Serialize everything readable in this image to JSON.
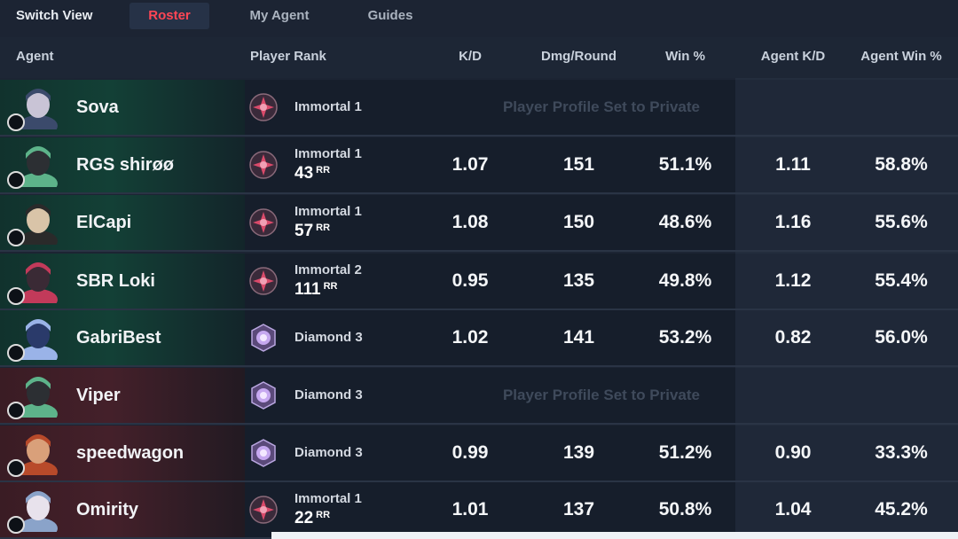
{
  "nav": {
    "switch_view": "Switch View",
    "tabs": [
      {
        "label": "Roster",
        "active": true
      },
      {
        "label": "My Agent",
        "active": false
      },
      {
        "label": "Guides",
        "active": false
      }
    ]
  },
  "columns": {
    "agent": "Agent",
    "player_rank": "Player Rank",
    "kd": "K/D",
    "dmg_round": "Dmg/Round",
    "win_pct": "Win %",
    "agent_kd": "Agent K/D",
    "agent_win_pct": "Agent Win %"
  },
  "colors": {
    "accent_red": "#ff4655",
    "team_green": "#134036",
    "team_red": "#44202a"
  },
  "rows": [
    {
      "agent_icon": "sova-portrait",
      "role_icon": "initiator-icon",
      "name": "Sova",
      "team": "green",
      "rank_icon": "immortal-icon",
      "rank": "Immortal 1",
      "rr": "",
      "rr_label": "",
      "private": true,
      "private_text": "Player Profile Set to Private",
      "kd": "",
      "dmg": "",
      "win": "",
      "agent_kd": "",
      "agent_win": ""
    },
    {
      "agent_icon": "viper-portrait",
      "role_icon": "controller-icon",
      "name": "RGS shirøø",
      "team": "green",
      "rank_icon": "immortal-icon",
      "rank": "Immortal 1",
      "rr": "43",
      "rr_label": "RR",
      "private": false,
      "private_text": "",
      "kd": "1.07",
      "dmg": "151",
      "win": "51.1%",
      "agent_kd": "1.11",
      "agent_win": "58.8%"
    },
    {
      "agent_icon": "chamber-portrait",
      "role_icon": "sentinel-icon",
      "name": "ElCapi",
      "team": "green",
      "rank_icon": "immortal-icon",
      "rank": "Immortal 1",
      "rr": "57",
      "rr_label": "RR",
      "private": false,
      "private_text": "",
      "kd": "1.08",
      "dmg": "150",
      "win": "48.6%",
      "agent_kd": "1.16",
      "agent_win": "55.6%"
    },
    {
      "agent_icon": "yoru-portrait",
      "role_icon": "duelist-icon",
      "name": "SBR Loki",
      "team": "green",
      "rank_icon": "immortal-icon",
      "rank": "Immortal 2",
      "rr": "111",
      "rr_label": "RR",
      "private": false,
      "private_text": "",
      "kd": "0.95",
      "dmg": "135",
      "win": "49.8%",
      "agent_kd": "1.12",
      "agent_win": "55.4%"
    },
    {
      "agent_icon": "kayo-portrait",
      "role_icon": "initiator-icon",
      "name": "GabriBest",
      "team": "green",
      "rank_icon": "diamond-icon",
      "rank": "Diamond 3",
      "rr": "",
      "rr_label": "",
      "private": false,
      "private_text": "",
      "kd": "1.02",
      "dmg": "141",
      "win": "53.2%",
      "agent_kd": "0.82",
      "agent_win": "56.0%"
    },
    {
      "agent_icon": "viper-portrait",
      "role_icon": "controller-icon",
      "name": "Viper",
      "team": "red",
      "rank_icon": "diamond-icon",
      "rank": "Diamond 3",
      "rr": "",
      "rr_label": "",
      "private": true,
      "private_text": "Player Profile Set to Private",
      "kd": "",
      "dmg": "",
      "win": "",
      "agent_kd": "",
      "agent_win": ""
    },
    {
      "agent_icon": "phoenix-portrait",
      "role_icon": "initiator-icon",
      "name": "speedwagon",
      "team": "red",
      "rank_icon": "diamond-icon",
      "rank": "Diamond 3",
      "rr": "",
      "rr_label": "",
      "private": false,
      "private_text": "",
      "kd": "0.99",
      "dmg": "139",
      "win": "51.2%",
      "agent_kd": "0.90",
      "agent_win": "33.3%"
    },
    {
      "agent_icon": "jett-portrait",
      "role_icon": "duelist-icon",
      "name": "Omirity",
      "team": "red",
      "rank_icon": "immortal-icon",
      "rank": "Immortal 1",
      "rr": "22",
      "rr_label": "RR",
      "private": false,
      "private_text": "",
      "kd": "1.01",
      "dmg": "137",
      "win": "50.8%",
      "agent_kd": "1.04",
      "agent_win": "45.2%"
    }
  ]
}
